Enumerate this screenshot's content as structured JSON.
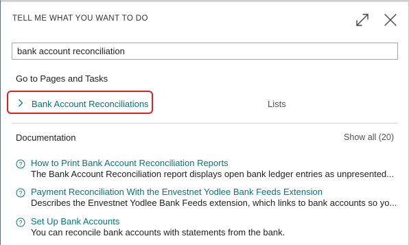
{
  "dialog": {
    "title": "TELL ME WHAT YOU WANT TO DO",
    "search_value": "bank account reconciliation"
  },
  "pages_section": {
    "heading": "Go to Pages and Tasks",
    "results": [
      {
        "label": "Bank Account Reconciliations",
        "category": "Lists"
      }
    ]
  },
  "documentation": {
    "heading": "Documentation",
    "show_all": "Show all (20)",
    "items": [
      {
        "title": "How to Print Bank Account Reconciliation Reports",
        "description": "The Bank Account Reconciliation report displays open bank ledger entries as unpresented..."
      },
      {
        "title": "Payment Reconciliation With the Envestnet Yodlee Bank Feeds Extension",
        "description": "Describes the Envestnet Yodlee Bank Feeds extension, which links to bank accounts so yo..."
      },
      {
        "title": "Set Up Bank Accounts",
        "description": "You can reconcile bank accounts with statements from the bank."
      }
    ]
  },
  "colors": {
    "link": "#00777f",
    "highlight_border": "#e02020"
  }
}
